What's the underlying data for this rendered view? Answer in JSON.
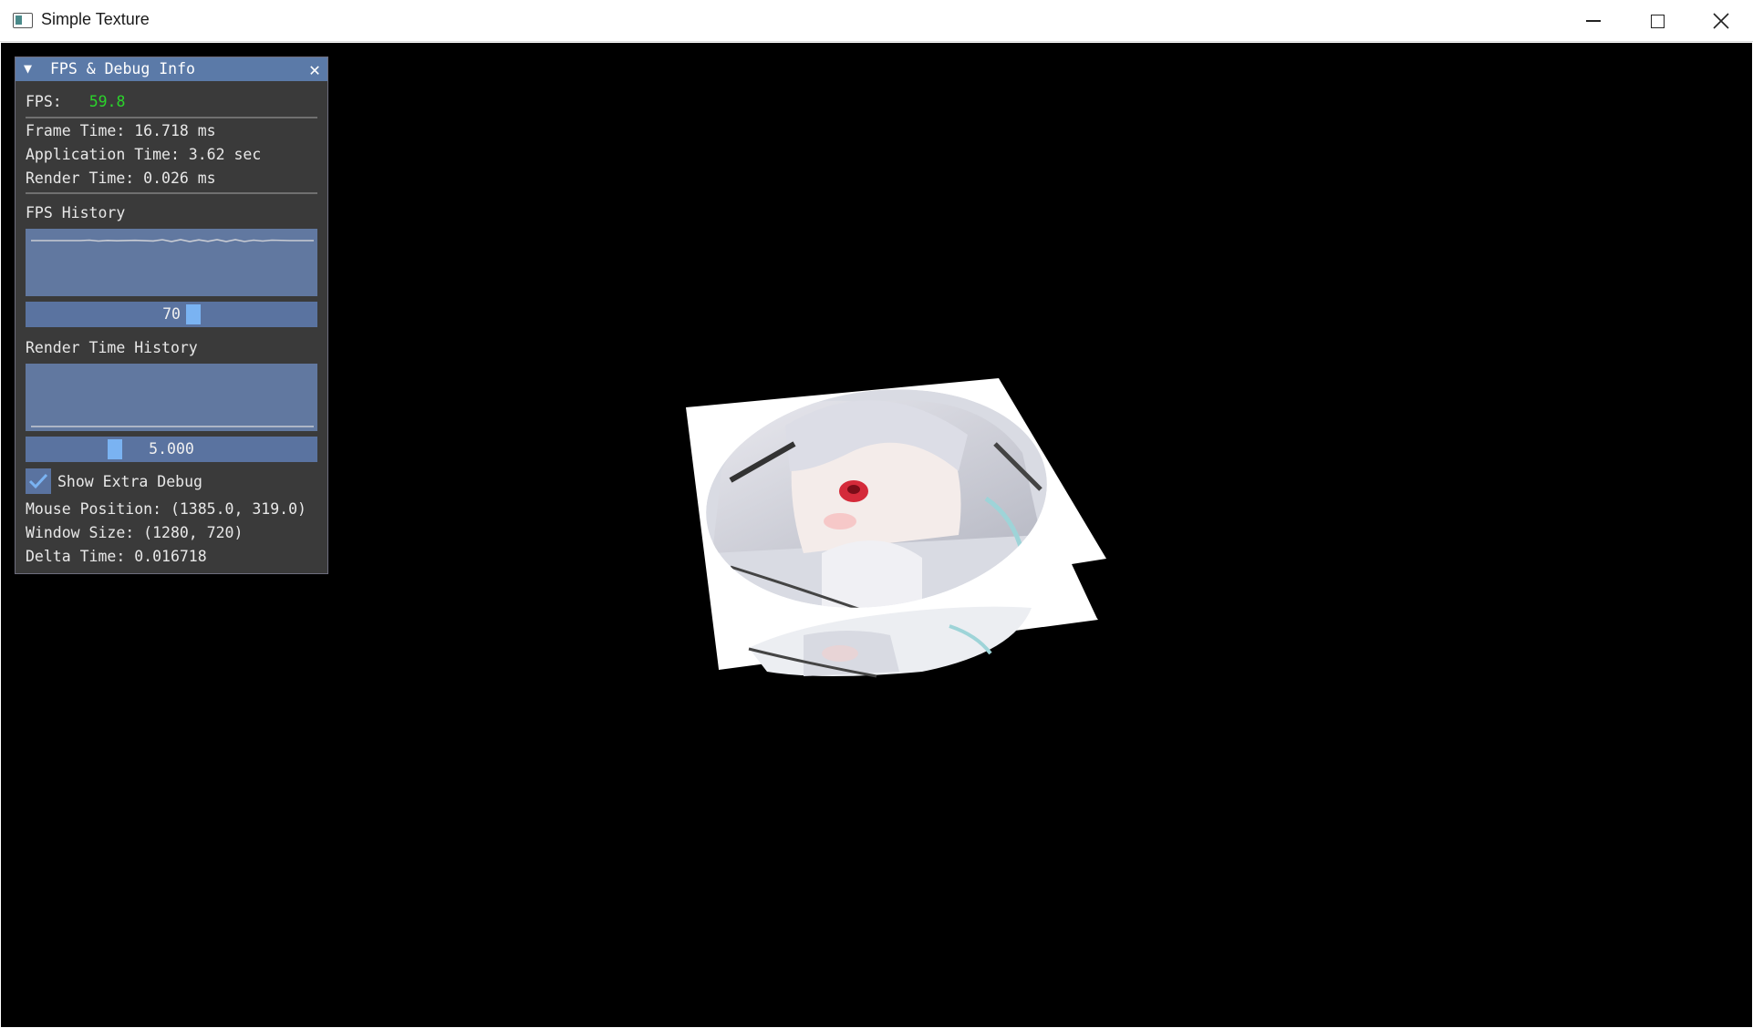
{
  "window": {
    "title": "Simple Texture"
  },
  "panel": {
    "title": "FPS & Debug Info",
    "fps_label": "FPS:",
    "fps_value": "59.8",
    "frame_time": "Frame Time: 16.718 ms",
    "application_time": "Application Time: 3.62 sec",
    "render_time": "Render Time: 0.026 ms",
    "fps_history_label": "FPS History",
    "fps_history_slider_value": "70",
    "render_history_label": "Render Time History",
    "render_history_slider_value": "5.000",
    "show_extra_debug_label": "Show Extra Debug",
    "show_extra_debug_checked": true,
    "mouse_position": "Mouse Position: (1385.0, 319.0)",
    "window_size": "Window Size: (1280, 720)",
    "delta_time": "Delta Time: 0.016718"
  },
  "colors": {
    "title_bar": "#5b7aa8",
    "panel_bg": "#3a3a3a",
    "frame_bg": "#5a73a0",
    "slider_grab": "#7ab3f2",
    "fps_text": "#2bd42b",
    "viewport_bg": "#000000"
  },
  "icons": {
    "app": "app-window-icon",
    "collapse": "triangle-down-icon",
    "close": "close-icon",
    "check": "checkmark-icon"
  }
}
